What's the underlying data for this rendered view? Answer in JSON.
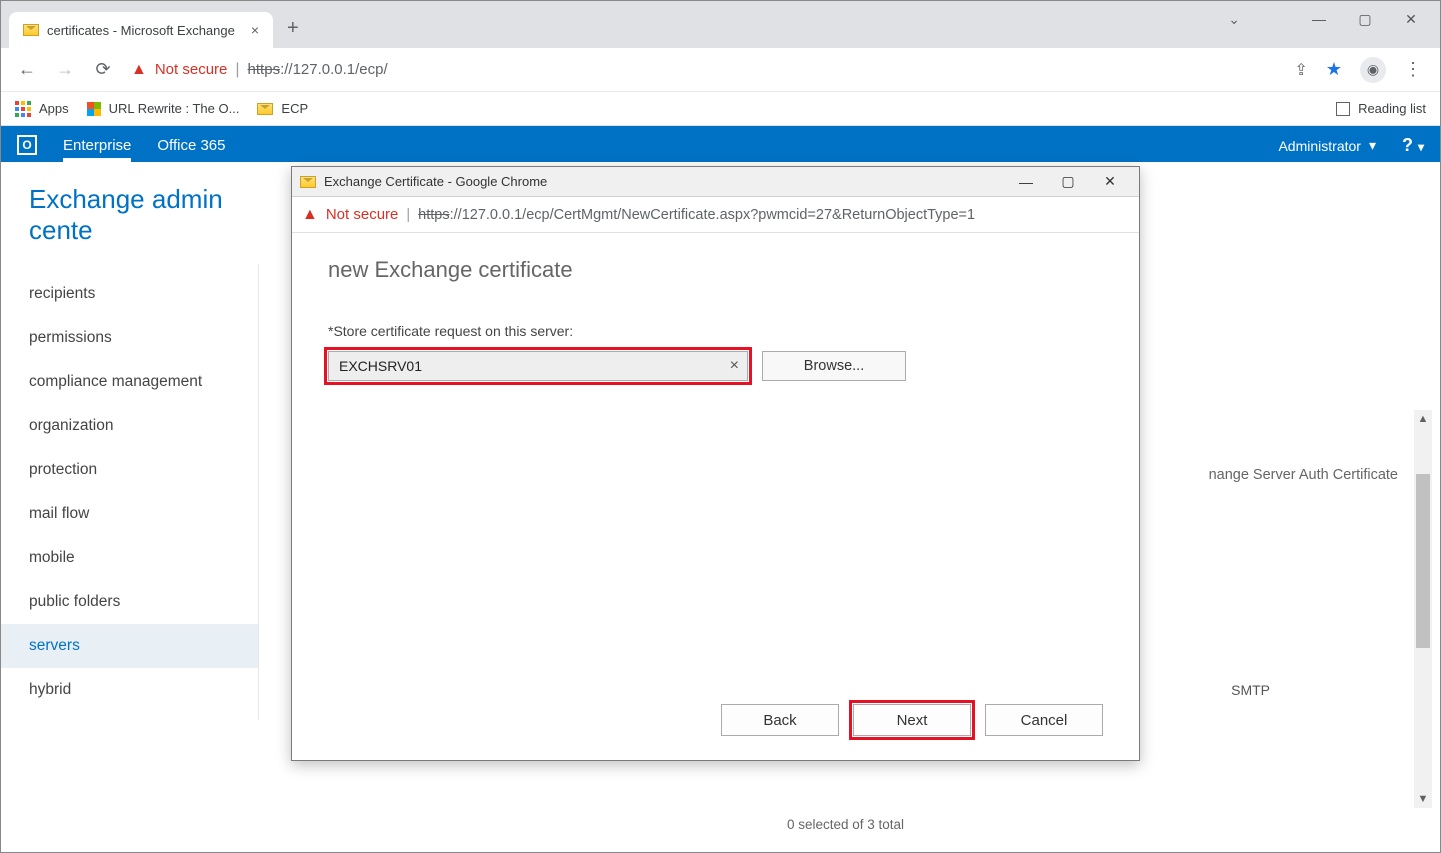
{
  "browser": {
    "tab_title": "certificates - Microsoft Exchange",
    "url_protocol": "https",
    "url_rest": "://127.0.0.1/ecp/",
    "not_secure": "Not secure",
    "bookmarks": {
      "apps": "Apps",
      "rewrite": "URL Rewrite : The O...",
      "ecp": "ECP",
      "reading": "Reading list"
    }
  },
  "mast": {
    "enterprise": "Enterprise",
    "office": "Office 365",
    "admin": "Administrator"
  },
  "page_title": "Exchange admin cente",
  "sidebar": [
    "recipients",
    "permissions",
    "compliance management",
    "organization",
    "protection",
    "mail flow",
    "mobile",
    "public folders",
    "servers",
    "hybrid"
  ],
  "sidebar_active_index": 8,
  "detail_partial": "nange Server Auth Certificate",
  "smtp_label": "SMTP",
  "footer": "0 selected of 3 total",
  "popup": {
    "title": "Exchange Certificate - Google Chrome",
    "not_secure": "Not secure",
    "url_protocol": "https",
    "url_rest": "://127.0.0.1/ecp/CertMgmt/NewCertificate.aspx?pwmcid=27&ReturnObjectType=1",
    "heading": "new Exchange certificate",
    "field_label": "*Store certificate request on this server:",
    "server_value": "EXCHSRV01",
    "browse": "Browse...",
    "back": "Back",
    "next": "Next",
    "cancel": "Cancel"
  }
}
